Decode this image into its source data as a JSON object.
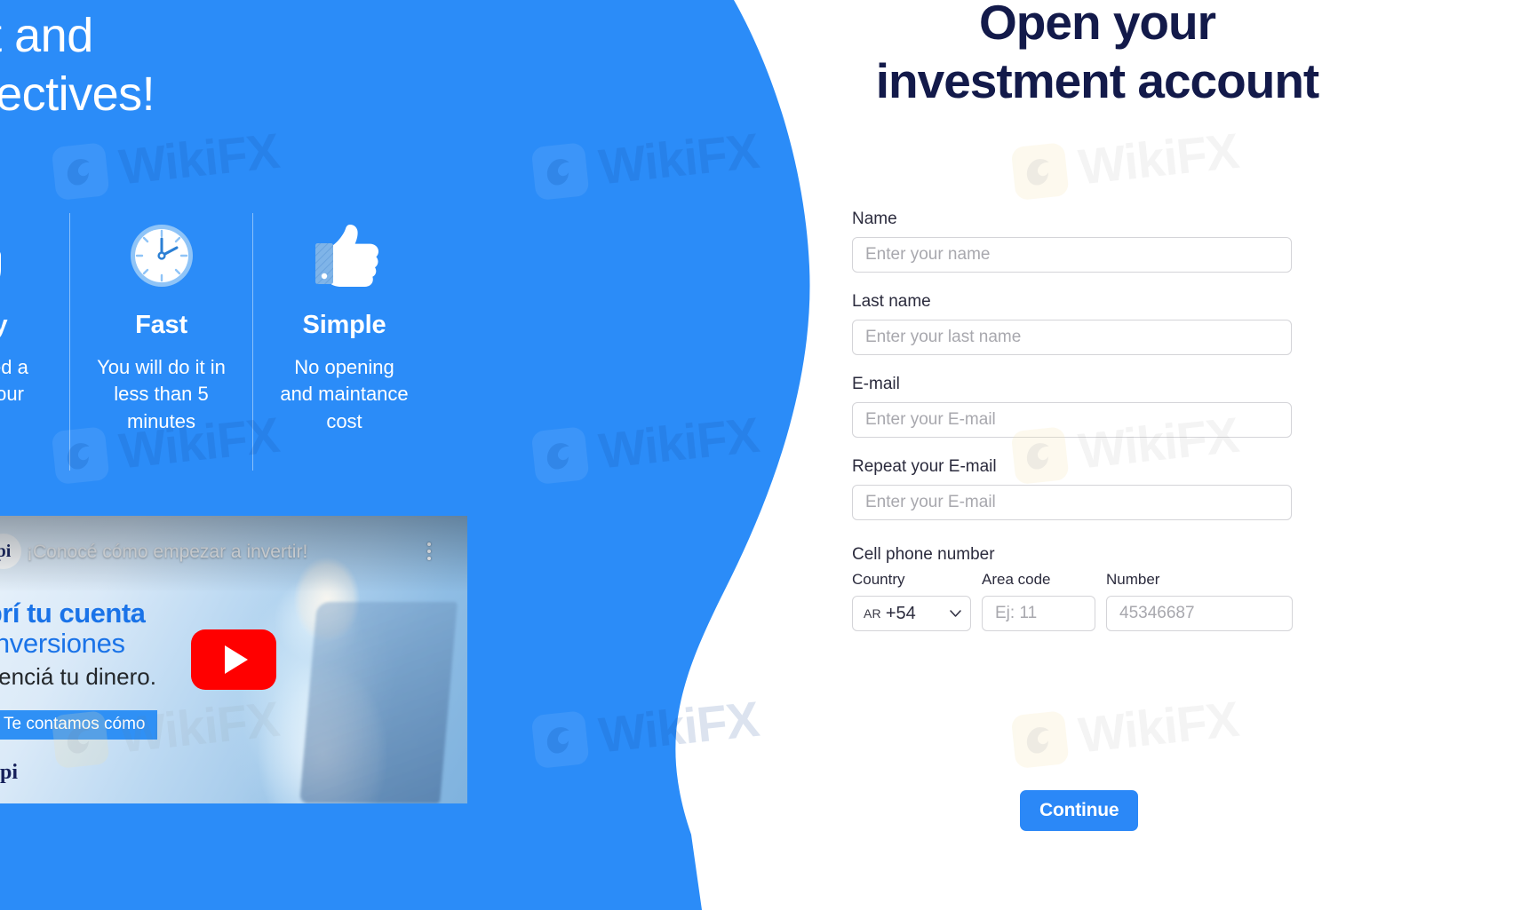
{
  "colors": {
    "brand_blue": "#2b88f7",
    "panel_blue": "#2b8cf8",
    "heading_navy": "#131a4a",
    "label_dark": "#2b2b3d",
    "placeholder_gray": "#a8a8ae",
    "input_border": "#d4d4d8",
    "youtube_red": "#ff0000",
    "video_headline_blue": "#1a73e8"
  },
  "hero": {
    "heading": "...re to invest and\n...fill your objectives!",
    "heading_line1": "re to invest and",
    "heading_line2": "fill your objectives!"
  },
  "features": [
    {
      "icon": "pointing-hand-icon",
      "title": "Easy",
      "desc": "only need a\ne and your\nID"
    },
    {
      "icon": "clock-icon",
      "title": "Fast",
      "desc": "You will do it in\nless than 5\nminutes"
    },
    {
      "icon": "thumbs-up-icon",
      "title": "Simple",
      "desc": "No opening\nand maintance\ncost"
    }
  ],
  "video": {
    "avatar_initials": "pi",
    "title": "¡Conocé cómo empezar a invertir!",
    "overlay_line1": "Abrí tu cuenta",
    "overlay_line2": "e inversiones",
    "overlay_line3": "potenciá tu dinero.",
    "badge": "Te contamos cómo",
    "footer_logo": "pi",
    "play_icon": "youtube-play-icon",
    "menu_icon": "kebab-menu-icon"
  },
  "form": {
    "heading": "Open your investment account",
    "fields": [
      {
        "label": "Name",
        "placeholder": "Enter your name",
        "value": ""
      },
      {
        "label": "Last name",
        "placeholder": "Enter your last name",
        "value": ""
      },
      {
        "label": "E-mail",
        "placeholder": "Enter your E-mail",
        "value": ""
      },
      {
        "label": "Repeat your E-mail",
        "placeholder": "Enter your E-mail",
        "value": ""
      }
    ],
    "phone": {
      "label": "Cell phone number",
      "country_sublabel": "Country",
      "area_sublabel": "Area code",
      "number_sublabel": "Number",
      "country_iso": "AR",
      "country_dial_code": "+54",
      "country_chevron": "chevron-down-icon",
      "area_placeholder": "Ej: 11",
      "area_value": "",
      "number_placeholder": "45346687",
      "number_value": ""
    },
    "submit_label": "Continue"
  },
  "watermark": {
    "text": "WikiFX",
    "logo": "wikifx-eagle-logo"
  }
}
